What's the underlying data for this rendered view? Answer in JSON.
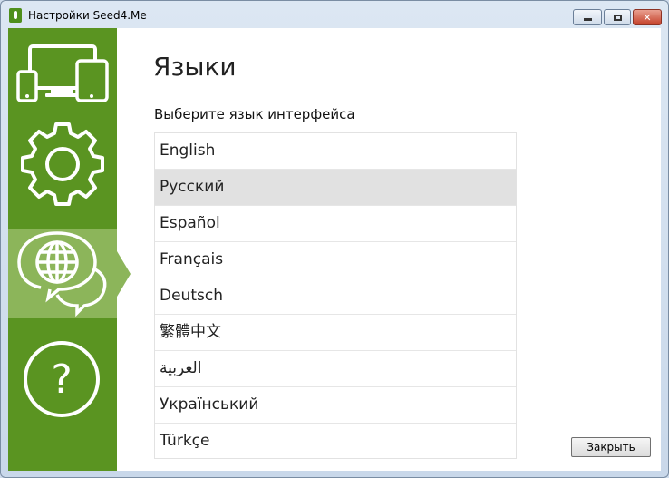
{
  "window": {
    "title": "Настройки Seed4.Me"
  },
  "main": {
    "heading": "Языки",
    "sublabel": "Выберите язык интерфейса",
    "languages": [
      {
        "label": "English"
      },
      {
        "label": "Русский",
        "selected": true
      },
      {
        "label": "Español"
      },
      {
        "label": "Français"
      },
      {
        "label": "Deutsch"
      },
      {
        "label": "繁體中文"
      },
      {
        "label": "العربية"
      },
      {
        "label": "Український"
      },
      {
        "label": "Türkçe"
      }
    ],
    "close_label": "Закрыть"
  },
  "colors": {
    "sidebar": "#5a9421",
    "sidebar_active": "#8cb55a",
    "selected_row": "#e1e1e1"
  },
  "sidebar": {
    "items": [
      {
        "icon": "devices-icon"
      },
      {
        "icon": "gear-icon"
      },
      {
        "icon": "globe-chat-icon",
        "active": true
      },
      {
        "icon": "help-icon"
      }
    ]
  }
}
